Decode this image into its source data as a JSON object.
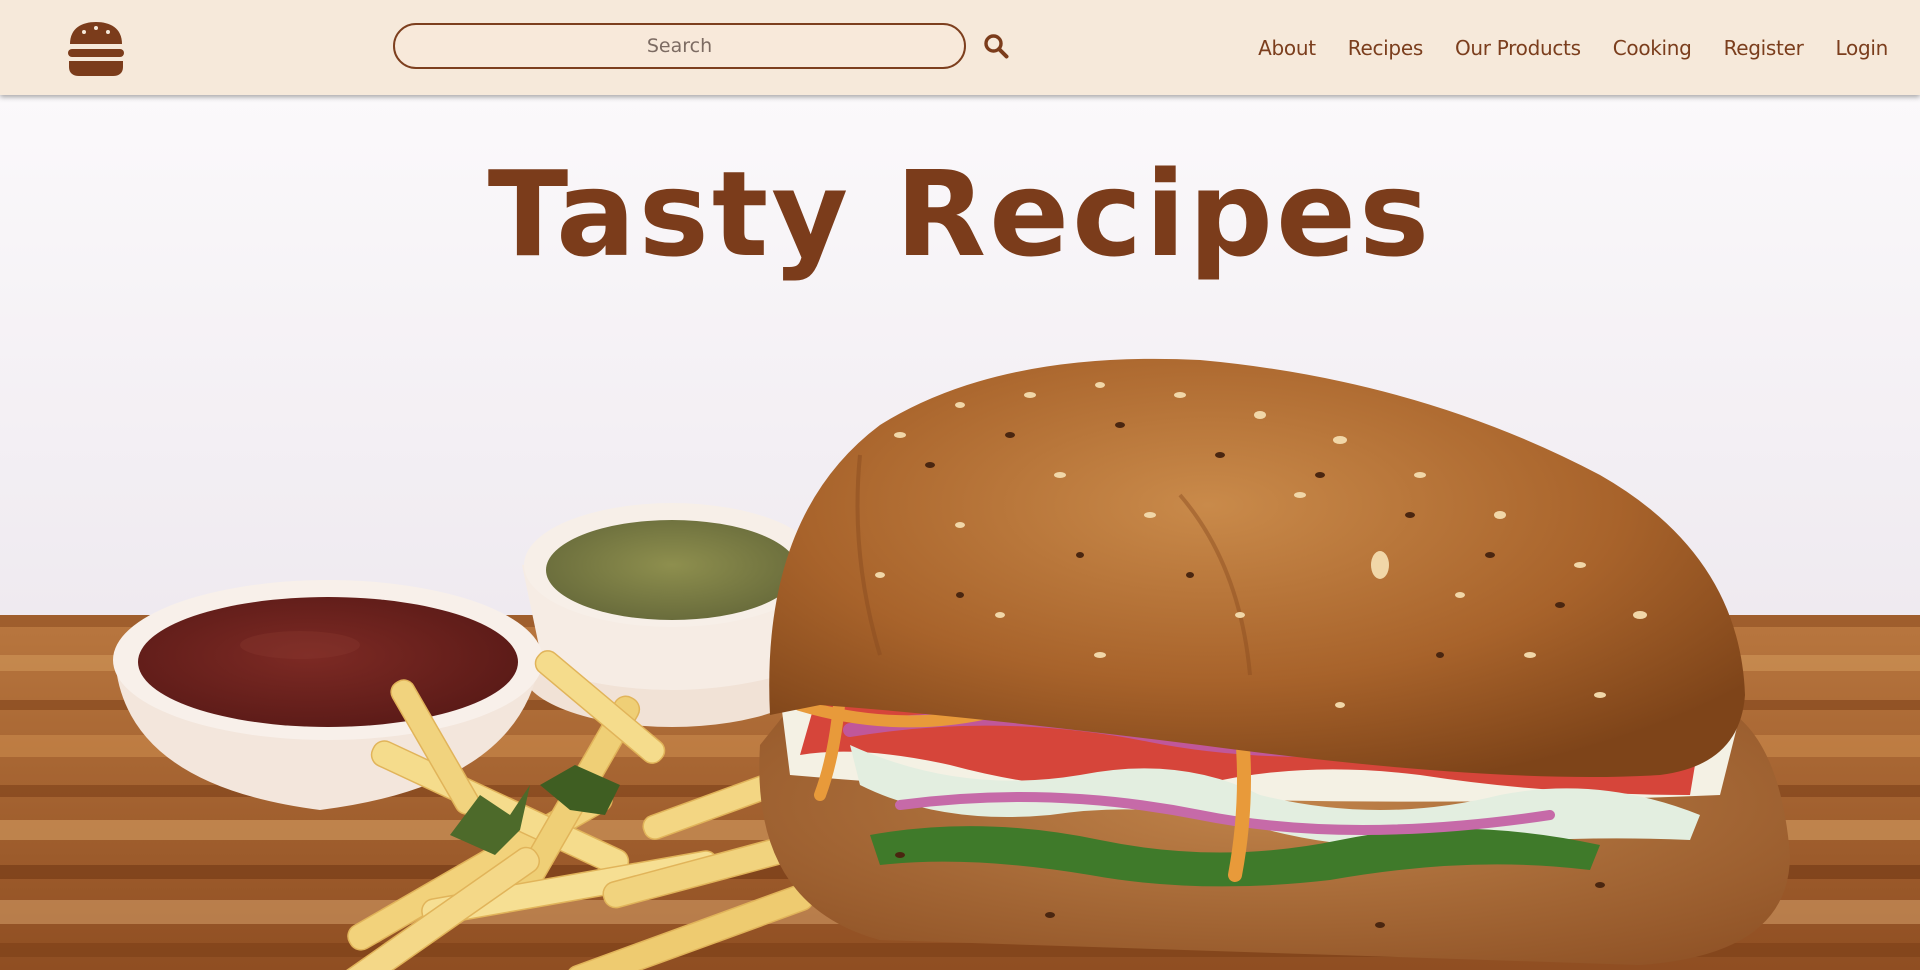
{
  "header": {
    "logo_icon": "burger-icon",
    "search": {
      "placeholder": "Search",
      "icon": "search-icon"
    },
    "nav": [
      "About",
      "Recipes",
      "Our Products",
      "Cooking",
      "Register",
      "Login"
    ]
  },
  "hero": {
    "title": "Tasty Recipes",
    "image": "sandwich-with-fries-and-dips-photo"
  },
  "colors": {
    "header_bg": "#f6e9da",
    "brand_brown": "#7b3c1b",
    "search_bg": "#f8e9da"
  }
}
